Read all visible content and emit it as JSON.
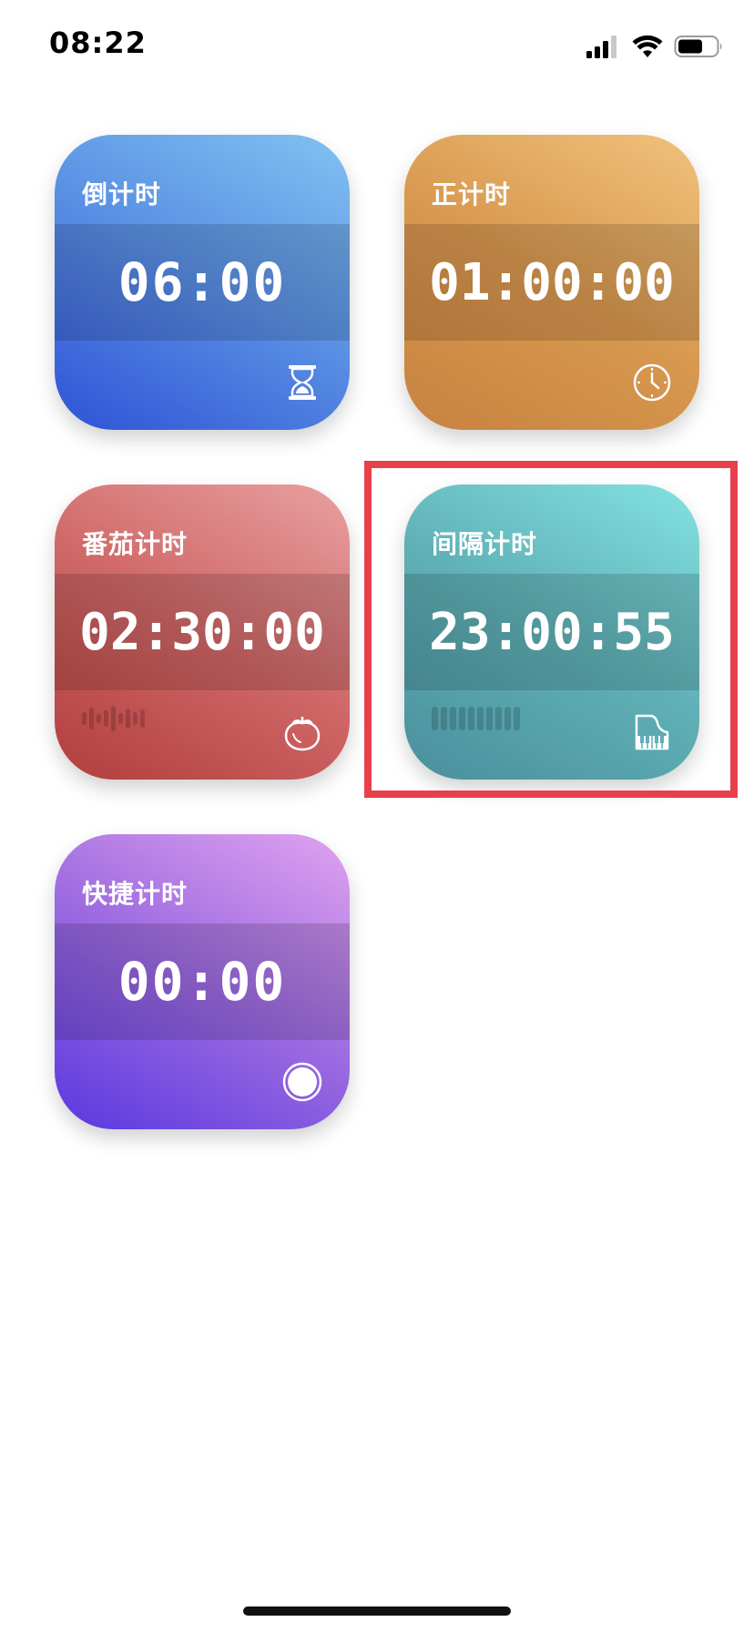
{
  "status_bar": {
    "time": "08:22",
    "icons": [
      "signal-icon",
      "wifi-icon",
      "battery-icon"
    ]
  },
  "cards": {
    "countdown": {
      "title": "倒计时",
      "time": "06:00",
      "icon": "hourglass-icon"
    },
    "stopwatch": {
      "title": "正计时",
      "time": "01:00:00",
      "icon": "clock-icon"
    },
    "tomato": {
      "title": "番茄计时",
      "time": "02:30:00",
      "icon": "tomato-icon"
    },
    "interval": {
      "title": "间隔计时",
      "time": "23:00:55",
      "icon": "piano-icon",
      "highlighted": true
    },
    "quick": {
      "title": "快捷计时",
      "time": "00:00",
      "icon": "record-button-icon"
    }
  },
  "colors": {
    "highlight": "#e8404b",
    "countdown": "#4a7ee0",
    "stopwatch": "#dca05a",
    "tomato": "#cc5f5f",
    "interval": "#5fb0b6",
    "quick": "#8a5ae2"
  }
}
